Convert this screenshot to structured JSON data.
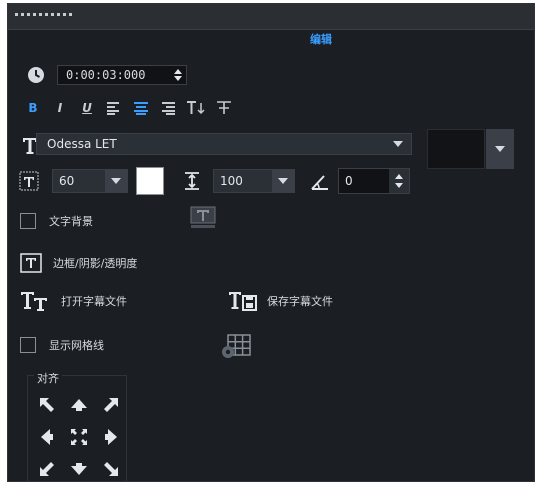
{
  "header": {
    "tab_label": "编辑"
  },
  "timecode": {
    "value": "0:00:03:000"
  },
  "format_toolbar": {
    "bold": "B",
    "italic": "I",
    "underline": "U"
  },
  "font": {
    "family_value": "Odessa LET"
  },
  "size": {
    "value": "60"
  },
  "line_spacing": {
    "value": "100"
  },
  "angle": {
    "value": "0"
  },
  "options": {
    "text_background": "文字背景",
    "border_shadow_transparency": "边框/阴影/透明度",
    "open_subtitle_file": "打开字幕文件",
    "save_subtitle_file": "保存字幕文件",
    "show_grid": "显示网格线"
  },
  "alignment": {
    "title": "对齐"
  },
  "colors": {
    "accent": "#3a9dff",
    "panel_bg": "#1b1e23",
    "text_color": "#ffffff"
  }
}
